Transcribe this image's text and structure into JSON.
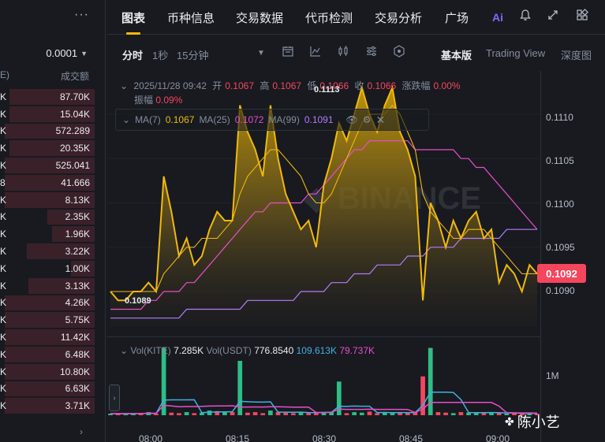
{
  "orderbook": {
    "precision": "0.0001",
    "col_left": "E)",
    "col_right": "成交额",
    "rows": [
      {
        "l": "K",
        "r": "87.70K",
        "fill": 0.9
      },
      {
        "l": "K",
        "r": "15.04K",
        "fill": 0.9
      },
      {
        "l": "K",
        "r": "572.289",
        "fill": 0.95
      },
      {
        "l": "K",
        "r": "20.35K",
        "fill": 0.9
      },
      {
        "l": "K",
        "r": "525.041",
        "fill": 0.95
      },
      {
        "l": "8",
        "r": "41.666",
        "fill": 0.95
      },
      {
        "l": "K",
        "r": "8.13K",
        "fill": 0.95
      },
      {
        "l": "K",
        "r": "2.35K",
        "fill": 0.5
      },
      {
        "l": "K",
        "r": "1.96K",
        "fill": 0.45
      },
      {
        "l": "K",
        "r": "3.22K",
        "fill": 0.72
      },
      {
        "l": "K",
        "r": "1.00K",
        "fill": 0.25
      },
      {
        "l": "K",
        "r": "3.13K",
        "fill": 0.7
      },
      {
        "l": "K",
        "r": "4.26K",
        "fill": 0.95
      },
      {
        "l": "K",
        "r": "5.75K",
        "fill": 0.95
      },
      {
        "l": "K",
        "r": "11.42K",
        "fill": 0.95
      },
      {
        "l": "K",
        "r": "6.48K",
        "fill": 0.95
      },
      {
        "l": "K",
        "r": "10.80K",
        "fill": 0.95
      },
      {
        "l": "K",
        "r": "6.63K",
        "fill": 0.95
      },
      {
        "l": "K",
        "r": "3.71K",
        "fill": 0.95
      }
    ]
  },
  "tabs": [
    "图表",
    "币种信息",
    "交易数据",
    "代币检测",
    "交易分析",
    "广场"
  ],
  "tab_ai": "Ai",
  "toolbar": {
    "time": "分时",
    "s1": "1秒",
    "m15": "15分钟",
    "basic": "基本版",
    "tradingview": "Trading View",
    "depth": "深度图"
  },
  "ohlc": {
    "time": "2025/11/28 09:42",
    "open_label": "开",
    "open": "0.1067",
    "high_label": "高",
    "high": "0.1067",
    "low_label": "低",
    "low": "0.1066",
    "close_label": "收",
    "close": "0.1066",
    "chg_label": "涨跌幅",
    "chg": "0.00%",
    "amp_label": "振幅",
    "amp": "0.09%"
  },
  "ma": {
    "ma7_label": "MA(7)",
    "ma7": "0.1067",
    "ma25_label": "MA(25)",
    "ma25": "0.1072",
    "ma99_label": "MA(99)",
    "ma99": "0.1091"
  },
  "price_axis": [
    "0.1110",
    "0.1105",
    "0.1100",
    "0.1095",
    "0.1090"
  ],
  "current_price": "0.1092",
  "annot_high": "0.1113",
  "annot_low": "0.1089",
  "time_axis": [
    "08:00",
    "08:15",
    "08:30",
    "08:45",
    "09:00"
  ],
  "volume": {
    "vol_label": "Vol(KITE)",
    "vol": "7.285K",
    "usdt_label": "Vol(USDT)",
    "usdt": "776.8540",
    "ma_a": "109.613K",
    "ma_b": "79.737K",
    "axis": "1M"
  },
  "watermark": "陈小艺",
  "colors": {
    "up": "#2ebd85",
    "down": "#f6465d",
    "line": "#f0b90b",
    "ma25": "#e84ecb",
    "ma99": "#b17cff"
  },
  "chart_data": {
    "type": "area",
    "y_range": [
      0.1086,
      0.1114
    ],
    "x_labels": [
      "08:00",
      "08:15",
      "08:30",
      "08:45",
      "09:00"
    ],
    "price": [
      0.109,
      0.1089,
      0.1089,
      0.109,
      0.109,
      0.1091,
      0.109,
      0.1103,
      0.1099,
      0.1094,
      0.1096,
      0.1093,
      0.1094,
      0.1097,
      0.1099,
      0.1098,
      0.1098,
      0.1111,
      0.1108,
      0.1106,
      0.1103,
      0.1111,
      0.1105,
      0.1101,
      0.1099,
      0.1097,
      0.1098,
      0.1095,
      0.1102,
      0.1105,
      0.1109,
      0.1107,
      0.111,
      0.1113,
      0.111,
      0.1108,
      0.1111,
      0.1113,
      0.1108,
      0.1106,
      0.1103,
      0.1089,
      0.11,
      0.1098,
      0.1095,
      0.1098,
      0.1096,
      0.1098,
      0.1099,
      0.1096,
      0.1097,
      0.1091,
      0.1093,
      0.1092,
      0.109,
      0.1093,
      0.1092
    ],
    "ma7": [
      0.109,
      0.109,
      0.109,
      0.109,
      0.109,
      0.109,
      0.109,
      0.1092,
      0.1093,
      0.1094,
      0.1095,
      0.1095,
      0.1096,
      0.1096,
      0.1096,
      0.1097,
      0.1098,
      0.1101,
      0.1103,
      0.1104,
      0.1105,
      0.1106,
      0.1106,
      0.1105,
      0.1104,
      0.1103,
      0.1101,
      0.11,
      0.11,
      0.1101,
      0.1103,
      0.1105,
      0.1107,
      0.1109,
      0.111,
      0.111,
      0.111,
      0.1111,
      0.111,
      0.1108,
      0.1106,
      0.1101,
      0.1099,
      0.1098,
      0.1097,
      0.1096,
      0.1096,
      0.1097,
      0.1097,
      0.1097,
      0.1096,
      0.1095,
      0.1094,
      0.1093,
      0.1092,
      0.1092,
      0.1092
    ],
    "ma25": [
      0.1088,
      0.1088,
      0.1088,
      0.1088,
      0.1088,
      0.1089,
      0.1089,
      0.109,
      0.109,
      0.109,
      0.1091,
      0.1091,
      0.1092,
      0.1093,
      0.1094,
      0.1095,
      0.1096,
      0.1097,
      0.1098,
      0.1099,
      0.1099,
      0.11,
      0.11,
      0.11,
      0.11,
      0.11,
      0.1101,
      0.1101,
      0.1102,
      0.1103,
      0.1104,
      0.1105,
      0.1106,
      0.1106,
      0.1107,
      0.1107,
      0.1107,
      0.1107,
      0.1107,
      0.1107,
      0.1106,
      0.1106,
      0.1106,
      0.1106,
      0.1106,
      0.1106,
      0.1105,
      0.1105,
      0.1104,
      0.1104,
      0.1103,
      0.1102,
      0.1101,
      0.11,
      0.1099,
      0.1098,
      0.1097
    ],
    "ma99": [
      0.1087,
      0.1087,
      0.1087,
      0.1087,
      0.1087,
      0.1087,
      0.1087,
      0.1087,
      0.1087,
      0.1087,
      0.1088,
      0.1088,
      0.1088,
      0.1088,
      0.1088,
      0.1088,
      0.1088,
      0.1088,
      0.1089,
      0.1089,
      0.1089,
      0.1089,
      0.1089,
      0.1089,
      0.1089,
      0.109,
      0.109,
      0.109,
      0.109,
      0.1091,
      0.1091,
      0.1091,
      0.1092,
      0.1092,
      0.1092,
      0.1093,
      0.1093,
      0.1093,
      0.1093,
      0.1094,
      0.1094,
      0.1094,
      0.1095,
      0.1095,
      0.1095,
      0.1095,
      0.1096,
      0.1096,
      0.1096,
      0.1096,
      0.1096,
      0.1096,
      0.1097,
      0.1097,
      0.1097,
      0.1097,
      0.1097
    ],
    "volume_range": [
      0,
      1400000
    ],
    "volume": [
      30000,
      30000,
      30000,
      30000,
      40000,
      60000,
      30000,
      1300000,
      50000,
      40000,
      60000,
      40000,
      50000,
      90000,
      80000,
      60000,
      60000,
      1050000,
      50000,
      60000,
      40000,
      90000,
      60000,
      50000,
      40000,
      60000,
      50000,
      40000,
      60000,
      70000,
      650000,
      40000,
      60000,
      50000,
      70000,
      40000,
      50000,
      40000,
      60000,
      50000,
      60000,
      750000,
      1300000,
      60000,
      50000,
      40000,
      60000,
      50000,
      40000,
      60000,
      50000,
      40000,
      30000,
      40000,
      30000,
      40000,
      30000
    ],
    "volume_dir": [
      1,
      0,
      1,
      1,
      0,
      1,
      0,
      1,
      0,
      0,
      1,
      0,
      1,
      1,
      0,
      1,
      0,
      1,
      0,
      0,
      0,
      1,
      0,
      0,
      0,
      1,
      0,
      0,
      1,
      1,
      1,
      0,
      1,
      1,
      0,
      0,
      1,
      1,
      0,
      0,
      0,
      0,
      1,
      0,
      0,
      1,
      0,
      1,
      1,
      0,
      1,
      0,
      1,
      0,
      0,
      1,
      0
    ]
  }
}
